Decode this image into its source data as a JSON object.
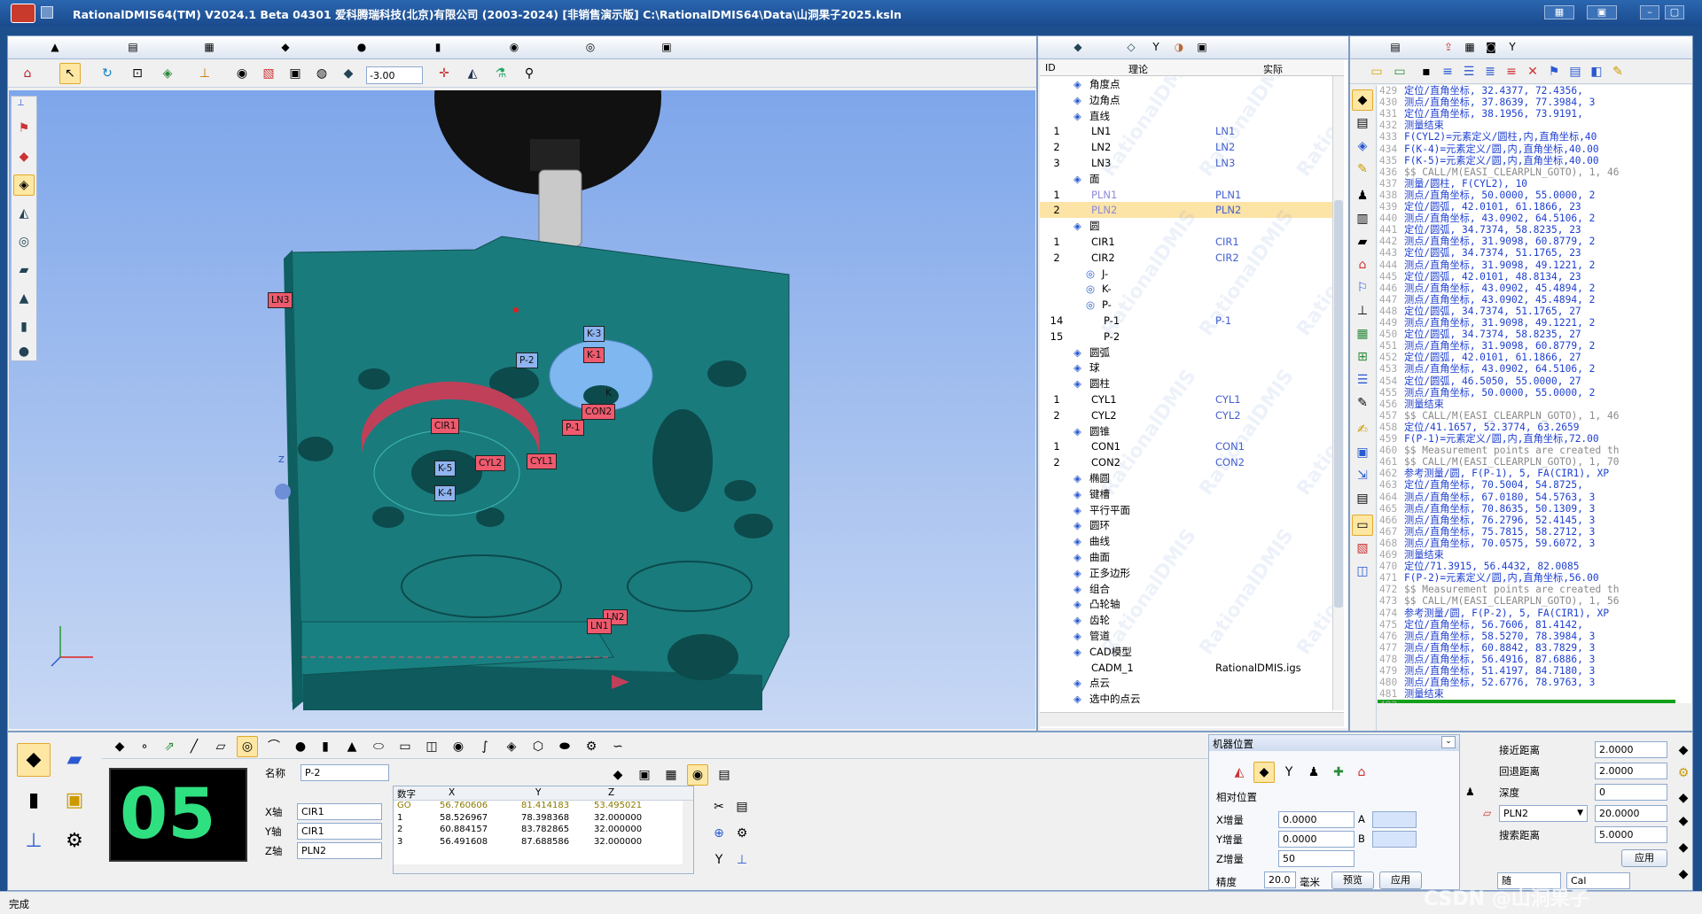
{
  "window": {
    "title": "RationalDMIS64(TM) V2024.1 Beta 04301   爱科腾瑞科技(北京)有限公司 (2003-2024) [非销售演示版]    C:\\RationalDMIS64\\Data\\山洞果子2025.ksln"
  },
  "toolbar": {
    "zoom_value": "-3.00"
  },
  "tree": {
    "col_id": "ID",
    "col_theory": "理论",
    "col_actual": "实际",
    "rows": [
      {
        "id": "",
        "name": "角度点",
        "actual": "",
        "indent": 1,
        "icon": "angle-point-icon"
      },
      {
        "id": "",
        "name": "边角点",
        "actual": "",
        "indent": 1,
        "icon": "edge-point-icon"
      },
      {
        "id": "",
        "name": "直线",
        "actual": "",
        "indent": 1,
        "icon": "line-icon"
      },
      {
        "id": "1",
        "name": "LN1",
        "actual": "LN1",
        "indent": 2,
        "icon": ""
      },
      {
        "id": "2",
        "name": "LN2",
        "actual": "LN2",
        "indent": 2,
        "icon": ""
      },
      {
        "id": "3",
        "name": "LN3",
        "actual": "LN3",
        "indent": 2,
        "icon": ""
      },
      {
        "id": "",
        "name": "面",
        "actual": "",
        "indent": 1,
        "icon": "plane-icon"
      },
      {
        "id": "1",
        "name": "PLN1",
        "actual": "PLN1",
        "indent": 2,
        "icon": ""
      },
      {
        "id": "2",
        "name": "PLN2",
        "actual": "PLN2",
        "indent": 2,
        "icon": "",
        "selected": true
      },
      {
        "id": "",
        "name": "圆",
        "actual": "",
        "indent": 1,
        "icon": "circle-icon"
      },
      {
        "id": "1",
        "name": "CIR1",
        "actual": "CIR1",
        "indent": 2,
        "icon": ""
      },
      {
        "id": "2",
        "name": "CIR2",
        "actual": "CIR2",
        "indent": 2,
        "icon": ""
      },
      {
        "id": "",
        "name": "J-",
        "actual": "",
        "indent": 2,
        "icon": "pattern-icon"
      },
      {
        "id": "",
        "name": "K-",
        "actual": "",
        "indent": 2,
        "icon": "pattern-icon"
      },
      {
        "id": "",
        "name": "P-",
        "actual": "",
        "indent": 2,
        "icon": "pattern-icon"
      },
      {
        "id": "14",
        "name": "P-1",
        "actual": "P-1",
        "indent": 3,
        "icon": ""
      },
      {
        "id": "15",
        "name": "P-2",
        "actual": "",
        "indent": 3,
        "icon": ""
      },
      {
        "id": "",
        "name": "圆弧",
        "actual": "",
        "indent": 1,
        "icon": "arc-icon"
      },
      {
        "id": "",
        "name": "球",
        "actual": "",
        "indent": 1,
        "icon": "sphere-icon"
      },
      {
        "id": "",
        "name": "圆柱",
        "actual": "",
        "indent": 1,
        "icon": "cylinder-icon"
      },
      {
        "id": "1",
        "name": "CYL1",
        "actual": "CYL1",
        "indent": 2,
        "icon": ""
      },
      {
        "id": "2",
        "name": "CYL2",
        "actual": "CYL2",
        "indent": 2,
        "icon": ""
      },
      {
        "id": "",
        "name": "圆锥",
        "actual": "",
        "indent": 1,
        "icon": "cone-icon"
      },
      {
        "id": "1",
        "name": "CON1",
        "actual": "CON1",
        "indent": 2,
        "icon": ""
      },
      {
        "id": "2",
        "name": "CON2",
        "actual": "CON2",
        "indent": 2,
        "icon": ""
      },
      {
        "id": "",
        "name": "椭圆",
        "actual": "",
        "indent": 1,
        "icon": "ellipse-icon"
      },
      {
        "id": "",
        "name": "键槽",
        "actual": "",
        "indent": 1,
        "icon": "slot-icon"
      },
      {
        "id": "",
        "name": "平行平面",
        "actual": "",
        "indent": 1,
        "icon": "parallel-plane-icon"
      },
      {
        "id": "",
        "name": "圆环",
        "actual": "",
        "indent": 1,
        "icon": "torus-icon"
      },
      {
        "id": "",
        "name": "曲线",
        "actual": "",
        "indent": 1,
        "icon": "curve-icon"
      },
      {
        "id": "",
        "name": "曲面",
        "actual": "",
        "indent": 1,
        "icon": "surface-icon"
      },
      {
        "id": "",
        "name": "正多边形",
        "actual": "",
        "indent": 1,
        "icon": "polygon-icon"
      },
      {
        "id": "",
        "name": "组合",
        "actual": "",
        "indent": 1,
        "icon": "group-icon"
      },
      {
        "id": "",
        "name": "凸轮轴",
        "actual": "",
        "indent": 1,
        "icon": "camshaft-icon"
      },
      {
        "id": "",
        "name": "齿轮",
        "actual": "",
        "indent": 1,
        "icon": "gear-icon"
      },
      {
        "id": "",
        "name": "管道",
        "actual": "",
        "indent": 1,
        "icon": "pipe-icon"
      },
      {
        "id": "",
        "name": "CAD模型",
        "actual": "",
        "indent": 1,
        "icon": "cad-icon"
      },
      {
        "id": "",
        "name": "CADM_1",
        "actual": "RationalDMIS.igs",
        "indent": 2,
        "icon": ""
      },
      {
        "id": "",
        "name": "点云",
        "actual": "",
        "indent": 1,
        "icon": "point-cloud-icon"
      },
      {
        "id": "",
        "name": "选中的点云",
        "actual": "",
        "indent": 1,
        "icon": "point-cloud-icon"
      }
    ],
    "watermark": "RationalDMIS"
  },
  "code": {
    "lines": [
      {
        "n": "429",
        "t": "  定位/直角坐标,   32.4377, 72.4356,",
        "c": "blue"
      },
      {
        "n": "430",
        "t": "  测点/直角坐标,   37.8639, 77.3984, 3",
        "c": "blue"
      },
      {
        "n": "431",
        "t": "  定位/直角坐标,   38.1956, 73.9191,",
        "c": "blue"
      },
      {
        "n": "432",
        "t": "测量结束",
        "c": "blue"
      },
      {
        "n": "433",
        "t": "F(CYL2)=元素定义/圆柱,内,直角坐标,40",
        "c": "blue"
      },
      {
        "n": "434",
        "t": "F(K-4)=元素定义/圆,内,直角坐标,40.00",
        "c": "blue"
      },
      {
        "n": "435",
        "t": "F(K-5)=元素定义/圆,内,直角坐标,40.00",
        "c": "blue"
      },
      {
        "n": "436",
        "t": "$$ CALL/M(EASI_CLEARPLN_GOTO), 1, 46",
        "c": "gray"
      },
      {
        "n": "437",
        "t": "测量/圆柱, F(CYL2), 10",
        "c": "blue"
      },
      {
        "n": "438",
        "t": "  测点/直角坐标,   50.0000, 55.0000, 2",
        "c": "blue"
      },
      {
        "n": "439",
        "t": "  定位/圆弧,    42.0101, 61.1866, 23",
        "c": "blue"
      },
      {
        "n": "440",
        "t": "  测点/直角坐标,   43.0902, 64.5106, 2",
        "c": "blue"
      },
      {
        "n": "441",
        "t": "  定位/圆弧,    34.7374, 58.8235, 23",
        "c": "blue"
      },
      {
        "n": "442",
        "t": "  测点/直角坐标,   31.9098, 60.8779, 2",
        "c": "blue"
      },
      {
        "n": "443",
        "t": "  定位/圆弧,    34.7374, 51.1765, 23",
        "c": "blue"
      },
      {
        "n": "444",
        "t": "  测点/直角坐标,   31.9098, 49.1221, 2",
        "c": "blue"
      },
      {
        "n": "445",
        "t": "  定位/圆弧,    42.0101, 48.8134, 23",
        "c": "blue"
      },
      {
        "n": "446",
        "t": "  测点/直角坐标,   43.0902, 45.4894, 2",
        "c": "blue"
      },
      {
        "n": "447",
        "t": "  测点/直角坐标,   43.0902, 45.4894, 2",
        "c": "blue"
      },
      {
        "n": "448",
        "t": "  定位/圆弧,    34.7374, 51.1765, 27",
        "c": "blue"
      },
      {
        "n": "449",
        "t": "  测点/直角坐标,   31.9098, 49.1221, 2",
        "c": "blue"
      },
      {
        "n": "450",
        "t": "  定位/圆弧,    34.7374, 58.8235, 27",
        "c": "blue"
      },
      {
        "n": "451",
        "t": "  测点/直角坐标,   31.9098, 60.8779, 2",
        "c": "blue"
      },
      {
        "n": "452",
        "t": "  定位/圆弧,    42.0101, 61.1866, 27",
        "c": "blue"
      },
      {
        "n": "453",
        "t": "  测点/直角坐标,   43.0902, 64.5106, 2",
        "c": "blue"
      },
      {
        "n": "454",
        "t": "  定位/圆弧,    46.5050, 55.0000, 27",
        "c": "blue"
      },
      {
        "n": "455",
        "t": "  测点/直角坐标,   50.0000, 55.0000, 2",
        "c": "blue"
      },
      {
        "n": "456",
        "t": "测量结束",
        "c": "blue"
      },
      {
        "n": "457",
        "t": "$$ CALL/M(EASI_CLEARPLN_GOTO), 1, 46",
        "c": "gray"
      },
      {
        "n": "458",
        "t": "定位/41.1657, 52.3774, 63.2659",
        "c": "blue"
      },
      {
        "n": "459",
        "t": "F(P-1)=元素定义/圆,内,直角坐标,72.00",
        "c": "blue"
      },
      {
        "n": "460",
        "t": "$$ Measurement points are created th",
        "c": "gray"
      },
      {
        "n": "461",
        "t": "$$ CALL/M(EASI_CLEARPLN_GOTO), 1, 70",
        "c": "gray"
      },
      {
        "n": "462",
        "t": "参考测量/圆, F(P-1), 5, FA(CIR1), XP",
        "c": "blue"
      },
      {
        "n": "463",
        "t": "  定位/直角坐标,   70.5004, 54.8725,",
        "c": "blue"
      },
      {
        "n": "464",
        "t": "  测点/直角坐标,   67.0180, 54.5763, 3",
        "c": "blue"
      },
      {
        "n": "465",
        "t": "  测点/直角坐标,   70.8635, 50.1309, 3",
        "c": "blue"
      },
      {
        "n": "466",
        "t": "  测点/直角坐标,   76.2796, 52.4145, 3",
        "c": "blue"
      },
      {
        "n": "467",
        "t": "  测点/直角坐标,   75.7815, 58.2712, 3",
        "c": "blue"
      },
      {
        "n": "468",
        "t": "  测点/直角坐标,   70.0575, 59.6072, 3",
        "c": "blue"
      },
      {
        "n": "469",
        "t": "测量结束",
        "c": "blue"
      },
      {
        "n": "470",
        "t": "定位/71.3915, 56.4432, 82.0085",
        "c": "blue"
      },
      {
        "n": "471",
        "t": "F(P-2)=元素定义/圆,内,直角坐标,56.00",
        "c": "blue"
      },
      {
        "n": "472",
        "t": "$$ Measurement points are created th",
        "c": "gray"
      },
      {
        "n": "473",
        "t": "$$ CALL/M(EASI_CLEARPLN_GOTO), 1, 56",
        "c": "gray"
      },
      {
        "n": "474",
        "t": "参考测量/圆, F(P-2), 5, FA(CIR1), XP",
        "c": "blue"
      },
      {
        "n": "475",
        "t": "  定位/直角坐标,   56.7606, 81.4142,",
        "c": "blue"
      },
      {
        "n": "476",
        "t": "  测点/直角坐标,   58.5270, 78.3984, 3",
        "c": "blue"
      },
      {
        "n": "477",
        "t": "  测点/直角坐标,   60.8842, 83.7829, 3",
        "c": "blue"
      },
      {
        "n": "478",
        "t": "  测点/直角坐标,   56.4916, 87.6886, 3",
        "c": "blue"
      },
      {
        "n": "479",
        "t": "  测点/直角坐标,   51.4197, 84.7180, 3",
        "c": "blue"
      },
      {
        "n": "480",
        "t": "  测点/直角坐标,   52.6776, 78.9763, 3",
        "c": "blue"
      },
      {
        "n": "481",
        "t": "测量结束",
        "c": "blue"
      },
      {
        "n": "482",
        "t": "",
        "c": "green"
      }
    ]
  },
  "viewport": {
    "labels": [
      {
        "name": "LN3",
        "c": "red"
      },
      {
        "name": "K-3",
        "c": "blue"
      },
      {
        "name": "K-1",
        "c": "red"
      },
      {
        "name": "P-2",
        "c": "blue"
      },
      {
        "name": "K",
        "c": "blue"
      },
      {
        "name": "CON2",
        "c": "red"
      },
      {
        "name": "P-1",
        "c": "red"
      },
      {
        "name": "CIR1",
        "c": "red"
      },
      {
        "name": "CYL2",
        "c": "red"
      },
      {
        "name": "CYL1",
        "c": "red"
      },
      {
        "name": "K-5",
        "c": "blue"
      },
      {
        "name": "K-4",
        "c": "blue"
      },
      {
        "name": "LN2",
        "c": "red"
      },
      {
        "name": "LN1",
        "c": "red"
      }
    ],
    "axis_z": "Z"
  },
  "feature": {
    "counter": "05",
    "name_label": "名称",
    "name_value": "P-2",
    "x_label": "X轴",
    "x_value": "CIR1",
    "y_label": "Y轴",
    "y_value": "CIR1",
    "z_label": "Z轴",
    "z_value": "PLN2",
    "table_headers": [
      "数字",
      "X",
      "Y",
      "Z"
    ],
    "table_rows": [
      [
        "GO",
        "56.760606",
        "81.414183",
        "53.495021"
      ],
      [
        "1",
        "58.526967",
        "78.398368",
        "32.000000"
      ],
      [
        "2",
        "60.884157",
        "83.782865",
        "32.000000"
      ],
      [
        "3",
        "56.491608",
        "87.688586",
        "32.000000"
      ]
    ]
  },
  "machine": {
    "title": "机器位置",
    "relative": "相对位置",
    "x_inc_label": "X增量",
    "x_inc": "0.0000",
    "a_label": "A",
    "y_inc_label": "Y增量",
    "y_inc": "0.0000",
    "b_label": "B",
    "z_inc_label": "Z增量",
    "z_inc": "50",
    "precision_label": "精度",
    "precision": "20.0",
    "unit": "毫米",
    "preview": "预览",
    "apply": "应用"
  },
  "params": {
    "approach_label": "接近距离",
    "approach": "2.0000",
    "retract_label": "回退距离",
    "retract": "2.0000",
    "depth_label": "深度",
    "depth": "0",
    "plane": "PLN2",
    "plane_value": "20.0000",
    "search_label": "搜索距离",
    "search": "5.0000",
    "apply": "应用",
    "combo1": "随",
    "combo2": "Cal"
  },
  "status": {
    "text": "完成",
    "watermark": "CSDN @山洞果子"
  }
}
